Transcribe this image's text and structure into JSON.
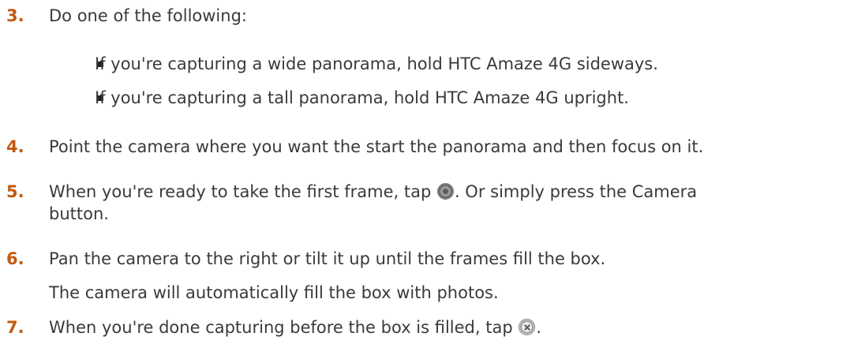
{
  "steps": [
    {
      "number": "3.",
      "text": "Do one of the following:"
    },
    {
      "number": "4.",
      "text": "Point the camera where you want the start the panorama and then focus on it."
    },
    {
      "number": "5.",
      "text_before_icon": "When you're ready to take the first frame, tap ",
      "text_after_icon": ". Or simply press the Camera",
      "continuation": "button.",
      "icon": "shutter-icon"
    },
    {
      "number": "6.",
      "text": "Pan the camera to the right or tilt it up until the frames fill the box.",
      "note": "The camera will automatically fill the box with photos."
    },
    {
      "number": "7.",
      "text_before_icon": "When you're done capturing before the box is filled, tap ",
      "text_after_icon": ".",
      "icon": "stop-icon"
    }
  ],
  "bullets": [
    "If you're capturing a wide panorama, hold HTC Amaze 4G sideways.",
    "If you're capturing a tall panorama, hold HTC Amaze 4G upright."
  ],
  "colors": {
    "step_number": "#c25a0e",
    "text": "#3a3a3a"
  }
}
